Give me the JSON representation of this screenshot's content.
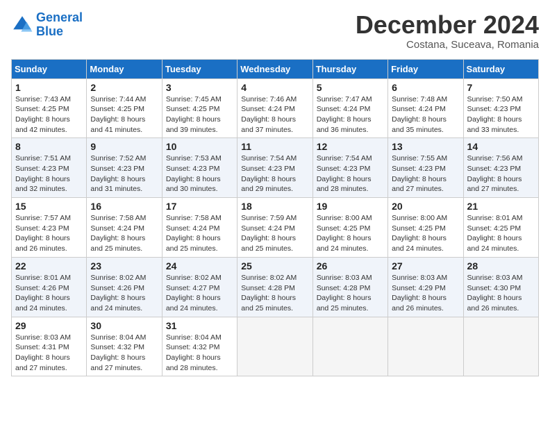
{
  "header": {
    "logo_line1": "General",
    "logo_line2": "Blue",
    "month": "December 2024",
    "location": "Costana, Suceava, Romania"
  },
  "weekdays": [
    "Sunday",
    "Monday",
    "Tuesday",
    "Wednesday",
    "Thursday",
    "Friday",
    "Saturday"
  ],
  "weeks": [
    [
      {
        "day": "1",
        "info": "Sunrise: 7:43 AM\nSunset: 4:25 PM\nDaylight: 8 hours\nand 42 minutes."
      },
      {
        "day": "2",
        "info": "Sunrise: 7:44 AM\nSunset: 4:25 PM\nDaylight: 8 hours\nand 41 minutes."
      },
      {
        "day": "3",
        "info": "Sunrise: 7:45 AM\nSunset: 4:25 PM\nDaylight: 8 hours\nand 39 minutes."
      },
      {
        "day": "4",
        "info": "Sunrise: 7:46 AM\nSunset: 4:24 PM\nDaylight: 8 hours\nand 37 minutes."
      },
      {
        "day": "5",
        "info": "Sunrise: 7:47 AM\nSunset: 4:24 PM\nDaylight: 8 hours\nand 36 minutes."
      },
      {
        "day": "6",
        "info": "Sunrise: 7:48 AM\nSunset: 4:24 PM\nDaylight: 8 hours\nand 35 minutes."
      },
      {
        "day": "7",
        "info": "Sunrise: 7:50 AM\nSunset: 4:23 PM\nDaylight: 8 hours\nand 33 minutes."
      }
    ],
    [
      {
        "day": "8",
        "info": "Sunrise: 7:51 AM\nSunset: 4:23 PM\nDaylight: 8 hours\nand 32 minutes."
      },
      {
        "day": "9",
        "info": "Sunrise: 7:52 AM\nSunset: 4:23 PM\nDaylight: 8 hours\nand 31 minutes."
      },
      {
        "day": "10",
        "info": "Sunrise: 7:53 AM\nSunset: 4:23 PM\nDaylight: 8 hours\nand 30 minutes."
      },
      {
        "day": "11",
        "info": "Sunrise: 7:54 AM\nSunset: 4:23 PM\nDaylight: 8 hours\nand 29 minutes."
      },
      {
        "day": "12",
        "info": "Sunrise: 7:54 AM\nSunset: 4:23 PM\nDaylight: 8 hours\nand 28 minutes."
      },
      {
        "day": "13",
        "info": "Sunrise: 7:55 AM\nSunset: 4:23 PM\nDaylight: 8 hours\nand 27 minutes."
      },
      {
        "day": "14",
        "info": "Sunrise: 7:56 AM\nSunset: 4:23 PM\nDaylight: 8 hours\nand 27 minutes."
      }
    ],
    [
      {
        "day": "15",
        "info": "Sunrise: 7:57 AM\nSunset: 4:23 PM\nDaylight: 8 hours\nand 26 minutes."
      },
      {
        "day": "16",
        "info": "Sunrise: 7:58 AM\nSunset: 4:24 PM\nDaylight: 8 hours\nand 25 minutes."
      },
      {
        "day": "17",
        "info": "Sunrise: 7:58 AM\nSunset: 4:24 PM\nDaylight: 8 hours\nand 25 minutes."
      },
      {
        "day": "18",
        "info": "Sunrise: 7:59 AM\nSunset: 4:24 PM\nDaylight: 8 hours\nand 25 minutes."
      },
      {
        "day": "19",
        "info": "Sunrise: 8:00 AM\nSunset: 4:25 PM\nDaylight: 8 hours\nand 24 minutes."
      },
      {
        "day": "20",
        "info": "Sunrise: 8:00 AM\nSunset: 4:25 PM\nDaylight: 8 hours\nand 24 minutes."
      },
      {
        "day": "21",
        "info": "Sunrise: 8:01 AM\nSunset: 4:25 PM\nDaylight: 8 hours\nand 24 minutes."
      }
    ],
    [
      {
        "day": "22",
        "info": "Sunrise: 8:01 AM\nSunset: 4:26 PM\nDaylight: 8 hours\nand 24 minutes."
      },
      {
        "day": "23",
        "info": "Sunrise: 8:02 AM\nSunset: 4:26 PM\nDaylight: 8 hours\nand 24 minutes."
      },
      {
        "day": "24",
        "info": "Sunrise: 8:02 AM\nSunset: 4:27 PM\nDaylight: 8 hours\nand 24 minutes."
      },
      {
        "day": "25",
        "info": "Sunrise: 8:02 AM\nSunset: 4:28 PM\nDaylight: 8 hours\nand 25 minutes."
      },
      {
        "day": "26",
        "info": "Sunrise: 8:03 AM\nSunset: 4:28 PM\nDaylight: 8 hours\nand 25 minutes."
      },
      {
        "day": "27",
        "info": "Sunrise: 8:03 AM\nSunset: 4:29 PM\nDaylight: 8 hours\nand 26 minutes."
      },
      {
        "day": "28",
        "info": "Sunrise: 8:03 AM\nSunset: 4:30 PM\nDaylight: 8 hours\nand 26 minutes."
      }
    ],
    [
      {
        "day": "29",
        "info": "Sunrise: 8:03 AM\nSunset: 4:31 PM\nDaylight: 8 hours\nand 27 minutes."
      },
      {
        "day": "30",
        "info": "Sunrise: 8:04 AM\nSunset: 4:32 PM\nDaylight: 8 hours\nand 27 minutes."
      },
      {
        "day": "31",
        "info": "Sunrise: 8:04 AM\nSunset: 4:32 PM\nDaylight: 8 hours\nand 28 minutes."
      },
      {
        "day": "",
        "info": ""
      },
      {
        "day": "",
        "info": ""
      },
      {
        "day": "",
        "info": ""
      },
      {
        "day": "",
        "info": ""
      }
    ]
  ]
}
